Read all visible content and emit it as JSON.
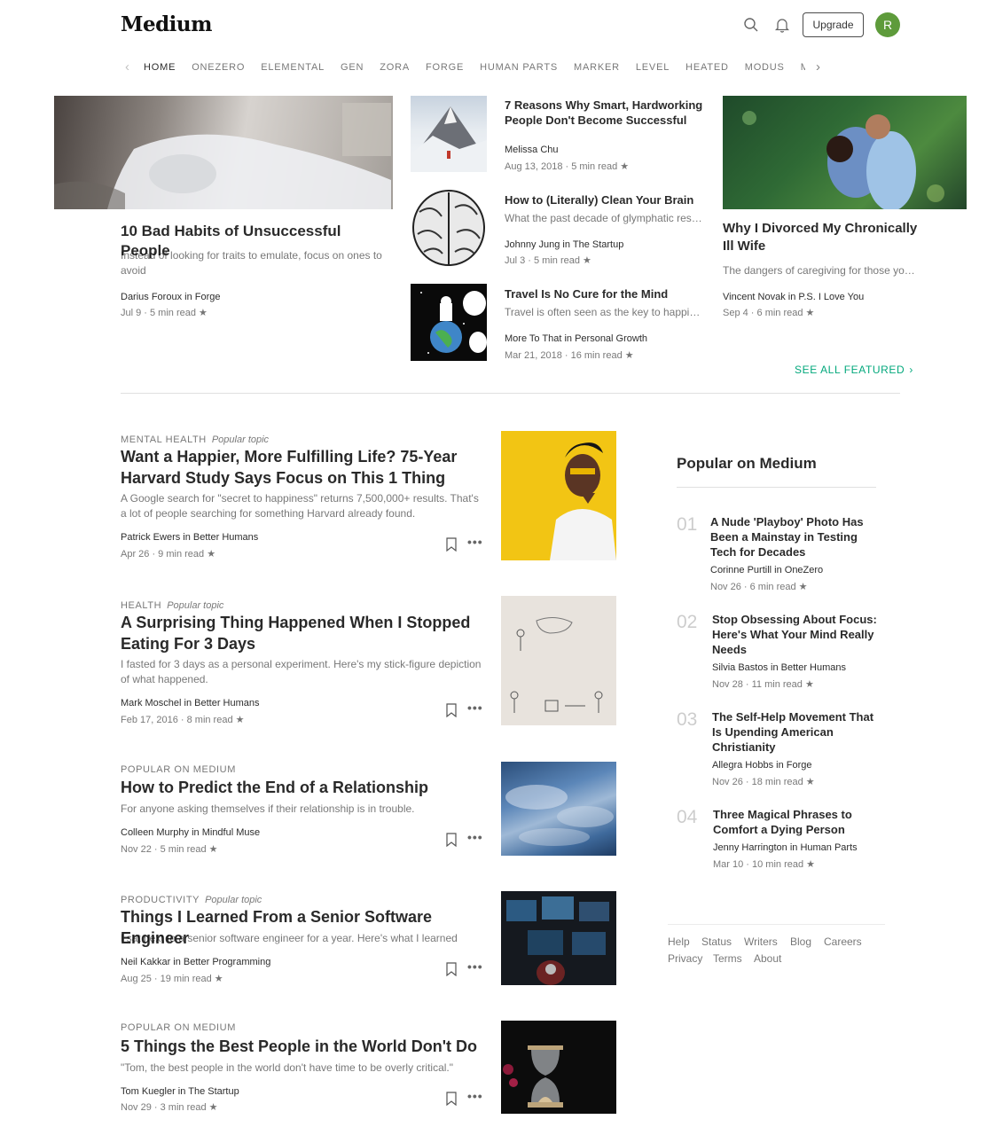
{
  "header": {
    "logo": "Medium",
    "upgrade_label": "Upgrade",
    "avatar_initial": "R",
    "icons": [
      "search-icon",
      "bell-icon"
    ]
  },
  "nav": {
    "items": [
      "HOME",
      "ONEZERO",
      "ELEMENTAL",
      "GEN",
      "ZORA",
      "FORGE",
      "HUMAN PARTS",
      "MARKER",
      "LEVEL",
      "HEATED",
      "MODUS",
      "MO"
    ],
    "active": "HOME"
  },
  "featured": {
    "main": {
      "title": "10 Bad Habits of Unsuccessful People",
      "subtitle": "Instead of looking for traits to emulate, focus on ones to avoid",
      "author": "Darius Foroux in Forge",
      "meta": "Jul 9 · 5 min read ★"
    },
    "middle": [
      {
        "title": "7 Reasons Why Smart, Hardworking People Don't Become Successful",
        "subtitle": "",
        "author": "Melissa Chu",
        "meta": "Aug 13, 2018 · 5 min read ★"
      },
      {
        "title": "How to (Literally) Clean Your Brain",
        "subtitle": "What the past decade of glymphatic research reveals",
        "author": "Johnny Jung in The Startup",
        "meta": "Jul 3 · 5 min read ★"
      },
      {
        "title": "Travel Is No Cure for the Mind",
        "subtitle": "Travel is often seen as the key to happiness",
        "author": "More To That in Personal Growth",
        "meta": "Mar 21, 2018 · 16 min read ★"
      }
    ],
    "right": {
      "title": "Why I Divorced My Chronically Ill Wife",
      "subtitle": "The dangers of caregiving for those you love",
      "author": "Vincent Novak in P.S. I Love You",
      "meta": "Sep 4 · 6 min read ★"
    },
    "see_all": "SEE ALL FEATURED"
  },
  "feed": [
    {
      "topic": "MENTAL HEALTH",
      "tag": "Popular topic",
      "title": "Want a Happier, More Fulfilling Life? 75-Year Harvard Study Says Focus on This 1 Thing",
      "subtitle": "A Google search for \"secret to happiness\" returns 7,500,000+ results. That's a lot of people searching for something Harvard already found.",
      "author": "Patrick Ewers in Better Humans",
      "meta": "Apr 26 · 9 min read ★"
    },
    {
      "topic": "HEALTH",
      "tag": "Popular topic",
      "title": "A Surprising Thing Happened When I Stopped Eating For 3 Days",
      "subtitle": "I fasted for 3 days as a personal experiment. Here's my stick-figure depiction of what happened.",
      "author": "Mark Moschel in Better Humans",
      "meta": "Feb 17, 2016 · 8 min read ★"
    },
    {
      "topic": "POPULAR ON MEDIUM",
      "tag": "",
      "title": "How to Predict the End of a Relationship",
      "subtitle": "For anyone asking themselves if their relationship is in trouble.",
      "author": "Colleen Murphy in Mindful Muse",
      "meta": "Nov 22 · 5 min read ★"
    },
    {
      "topic": "PRODUCTIVITY",
      "tag": "Popular topic",
      "title": "Things I Learned From a Senior Software Engineer",
      "subtitle": "I sat next to a senior software engineer for a year. Here's what I learned",
      "author": "Neil Kakkar in Better Programming",
      "meta": "Aug 25 · 19 min read ★"
    },
    {
      "topic": "POPULAR ON MEDIUM",
      "tag": "",
      "title": "5 Things the Best People in the World Don't Do",
      "subtitle": "\"Tom, the best people in the world don't have time to be overly critical.\"",
      "author": "Tom Kuegler in The Startup",
      "meta": "Nov 29 · 3 min read ★"
    }
  ],
  "popular": {
    "heading": "Popular on Medium",
    "items": [
      {
        "num": "01",
        "title": "A Nude 'Playboy' Photo Has Been a Mainstay in Testing Tech for Decades",
        "author": "Corinne Purtill in OneZero",
        "meta": "Nov 26 · 6 min read ★"
      },
      {
        "num": "02",
        "title": "Stop Obsessing About Focus: Here's What Your Mind Really Needs",
        "author": "Silvia Bastos in Better Humans",
        "meta": "Nov 28 · 11 min read ★"
      },
      {
        "num": "03",
        "title": "The Self-Help Movement That Is Upending American Christianity",
        "author": "Allegra Hobbs in Forge",
        "meta": "Nov 26 · 18 min read ★"
      },
      {
        "num": "04",
        "title": "Three Magical Phrases to Comfort a Dying Person",
        "author": "Jenny Harrington in Human Parts",
        "meta": "Mar 10 · 10 min read ★"
      }
    ]
  },
  "footer": {
    "links": [
      "Help",
      "Status",
      "Writers",
      "Blog",
      "Careers",
      "Privacy",
      "Terms",
      "About"
    ]
  },
  "colors": {
    "accent": "#03a87c",
    "avatar_bg": "#5e9b3b"
  }
}
